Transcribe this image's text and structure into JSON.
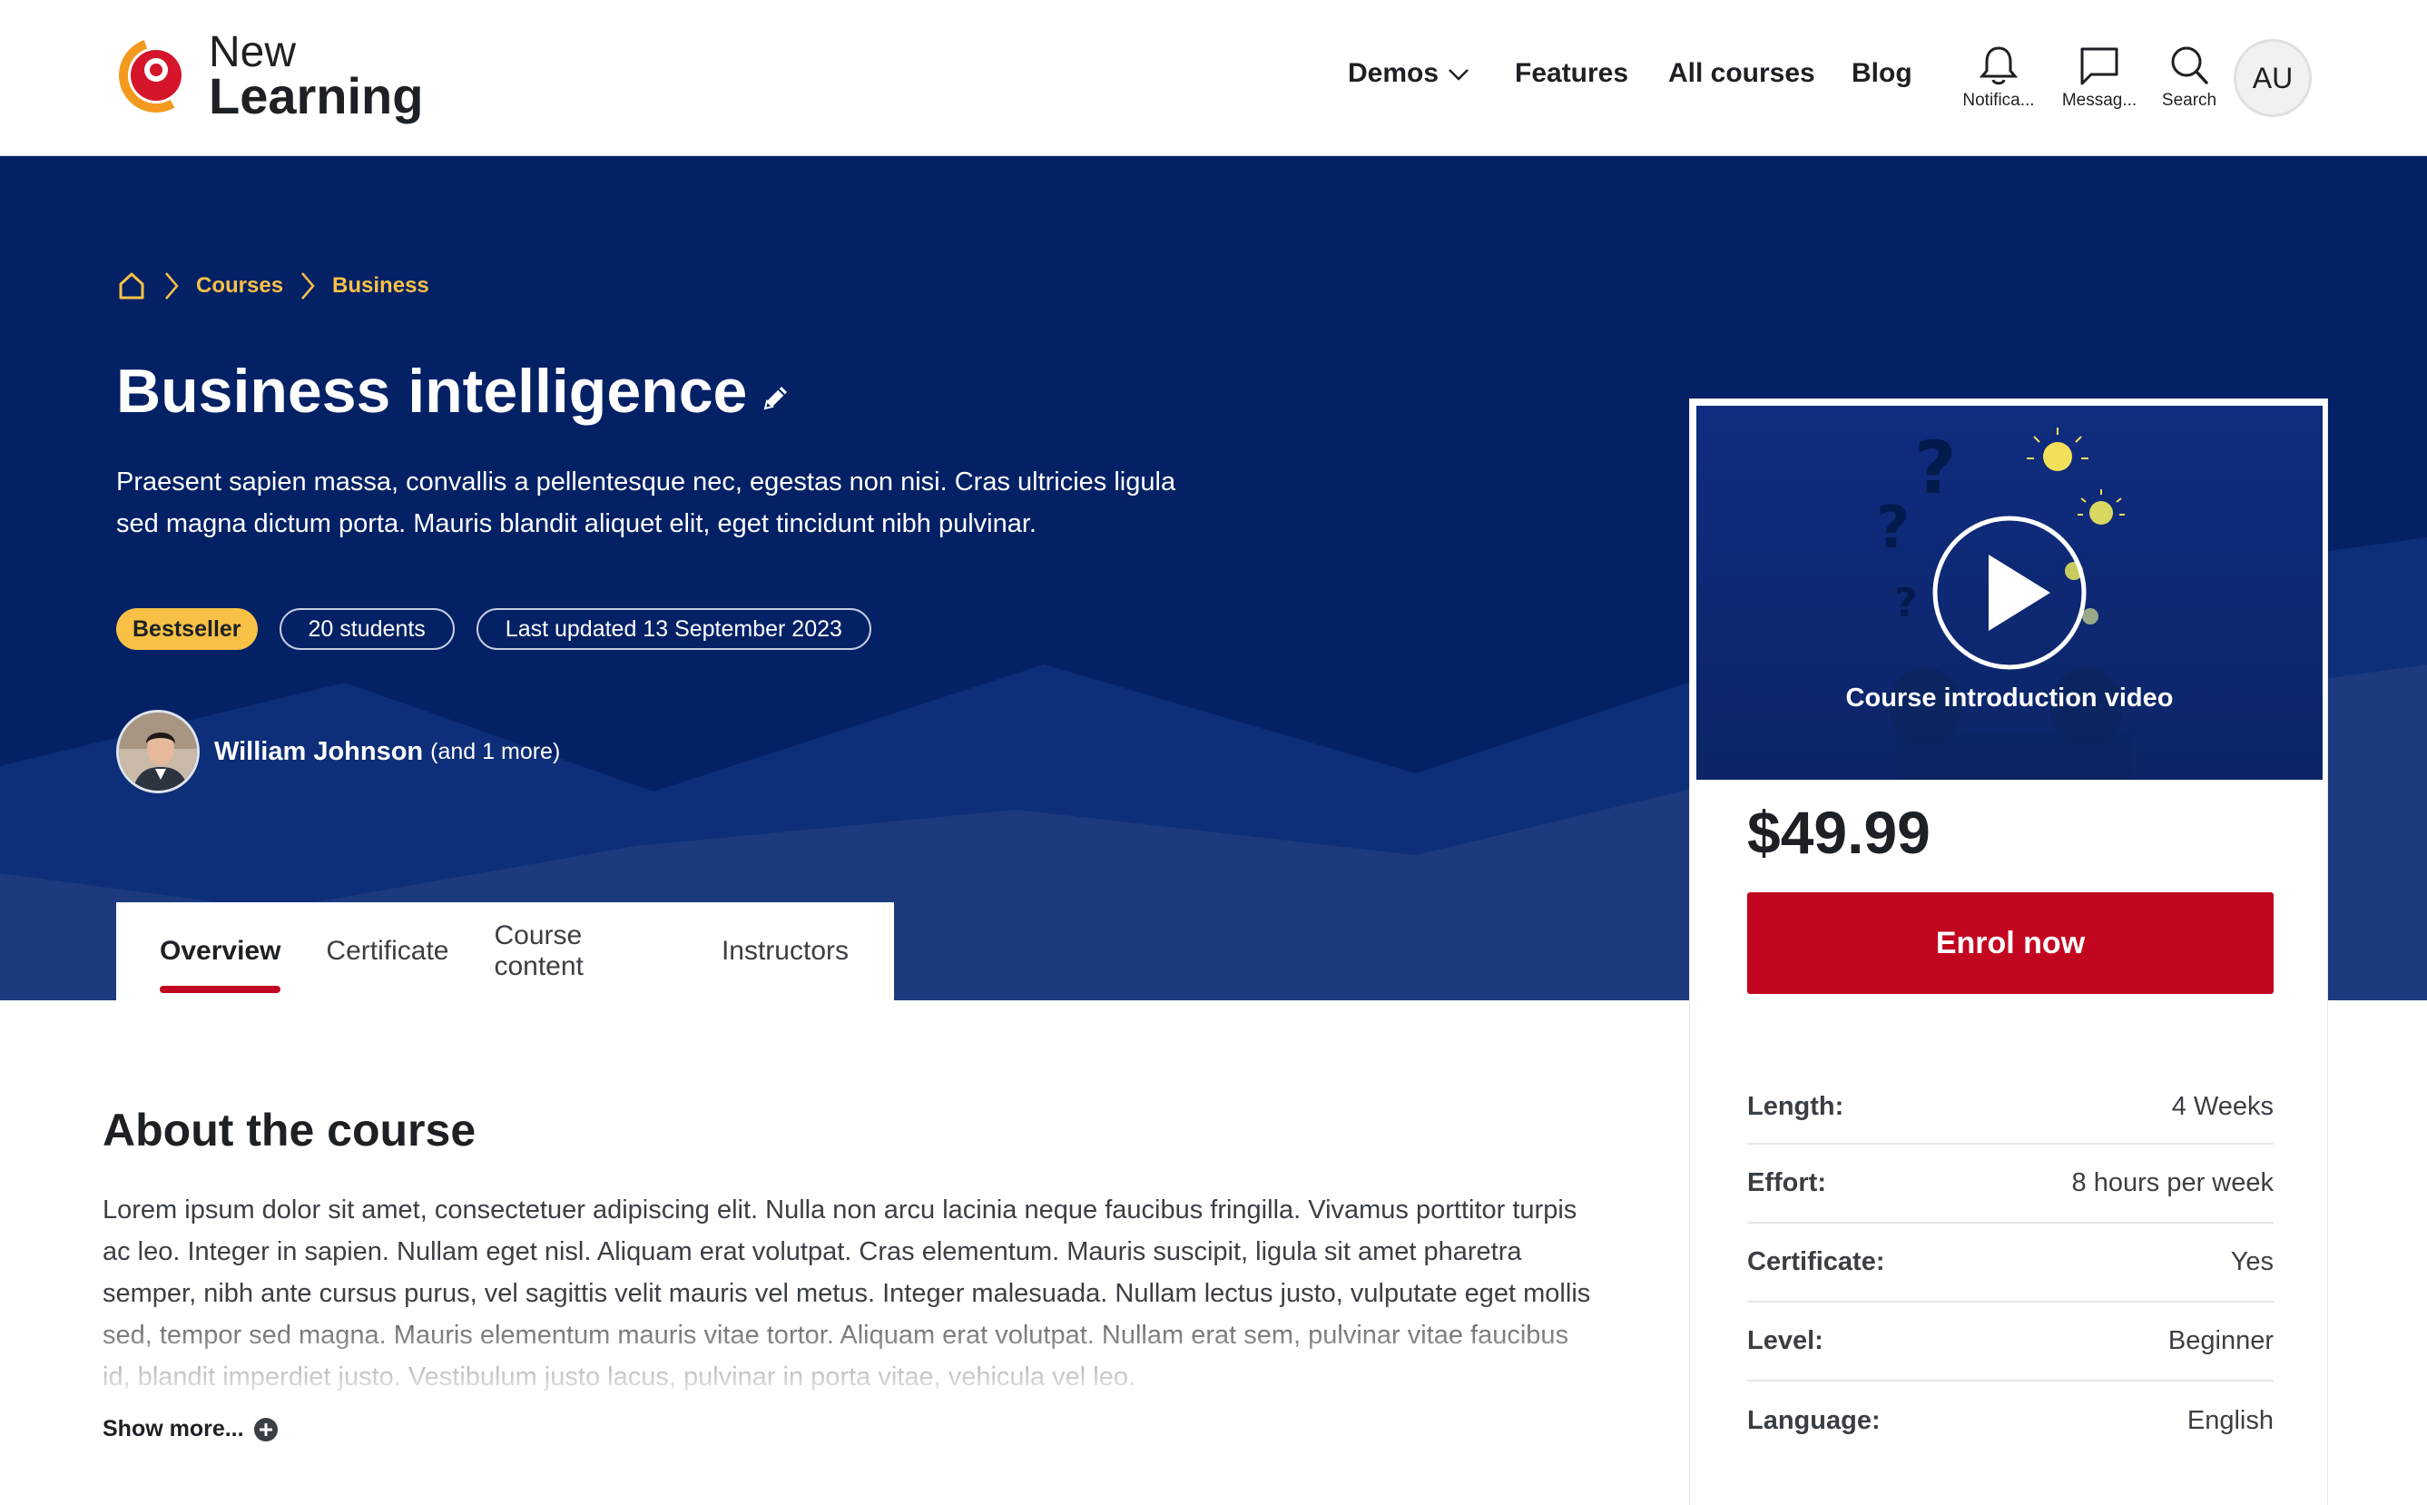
{
  "brand": {
    "line1": "New",
    "line2": "Learning"
  },
  "nav": {
    "demos": "Demos",
    "features": "Features",
    "all_courses": "All courses",
    "blog": "Blog",
    "notifications": "Notifica...",
    "messages": "Messag...",
    "search": "Search",
    "avatar_initials": "AU"
  },
  "breadcrumb": {
    "courses": "Courses",
    "business": "Business"
  },
  "course": {
    "title": "Business intelligence",
    "summary": "Praesent sapien massa, convallis a pellentesque nec, egestas non nisi. Cras ultricies ligula sed magna dictum porta. Mauris blandit aliquet elit, eget tincidunt nibh pulvinar.",
    "badge_bestseller": "Bestseller",
    "badge_students": "20 students",
    "badge_updated": "Last updated 13 September 2023",
    "author_name": "William Johnson",
    "author_more": "(and 1 more)"
  },
  "tabs": {
    "overview": "Overview",
    "certificate": "Certificate",
    "content": "Course content",
    "instructors": "Instructors"
  },
  "about": {
    "title": "About the course",
    "body": "Lorem ipsum dolor sit amet, consectetuer adipiscing elit. Nulla non arcu lacinia neque faucibus fringilla. Vivamus porttitor turpis ac leo. Integer in sapien. Nullam eget nisl. Aliquam erat volutpat. Cras elementum. Mauris suscipit, ligula sit amet pharetra semper, nibh ante cursus purus, vel sagittis velit mauris vel metus. Integer malesuada. Nullam lectus justo, vulputate eget mollis sed, tempor sed magna. Mauris elementum mauris vitae tortor. Aliquam erat volutpat. Nullam erat sem, pulvinar vitae faucibus id, blandit imperdiet justo. Vestibulum justo lacus, pulvinar in porta vitae, vehicula vel leo.",
    "show_more": "Show more..."
  },
  "card": {
    "video_label": "Course introduction video",
    "price": "$49.99",
    "enrol": "Enrol now",
    "facts": [
      {
        "k": "Length:",
        "v": "4 Weeks"
      },
      {
        "k": "Effort:",
        "v": "8 hours per week"
      },
      {
        "k": "Certificate:",
        "v": "Yes"
      },
      {
        "k": "Level:",
        "v": "Beginner"
      },
      {
        "k": "Language:",
        "v": "English"
      }
    ]
  },
  "colors": {
    "hero_bg": "#042166",
    "accent_red": "#c30620",
    "accent_yellow": "#f8c146"
  }
}
